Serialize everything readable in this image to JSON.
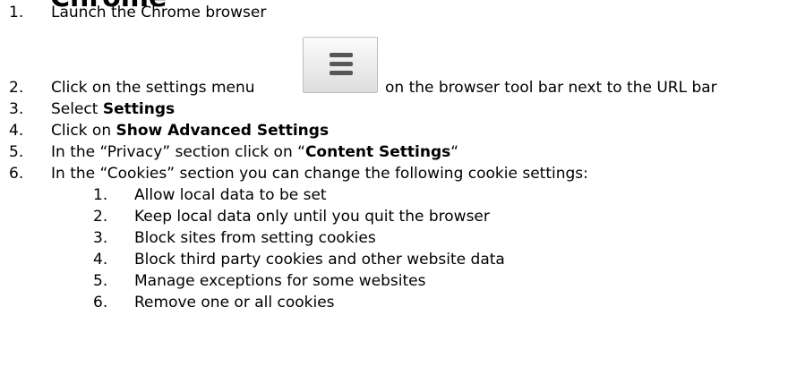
{
  "heading": "Chrome",
  "steps": [
    {
      "num": "1.",
      "text": "Launch the Chrome browser"
    },
    {
      "num": "2.",
      "before": "Click on the settings menu",
      "after": "on the browser tool bar next to the URL bar"
    },
    {
      "num": "3.",
      "before": "Select ",
      "bold": "Settings"
    },
    {
      "num": "4.",
      "before": "Click on ",
      "bold": "Show Advanced Settings"
    },
    {
      "num": "5.",
      "before": "In the “Privacy” section click on “",
      "bold": "Content Settings",
      "after": "“"
    },
    {
      "num": "6.",
      "text": "In the “Cookies” section you can change the following cookie settings:"
    }
  ],
  "substeps": [
    {
      "num": "1.",
      "text": "Allow local data to be set"
    },
    {
      "num": "2.",
      "text": "Keep local data only until you quit the browser"
    },
    {
      "num": "3.",
      "text": "Block sites from setting cookies"
    },
    {
      "num": "4.",
      "text": "Block third party cookies and other website data"
    },
    {
      "num": "5.",
      "text": "Manage exceptions for some websites"
    },
    {
      "num": "6.",
      "text": "Remove one or all cookies"
    }
  ],
  "icons": {
    "settings_menu": "hamburger-menu-icon"
  }
}
